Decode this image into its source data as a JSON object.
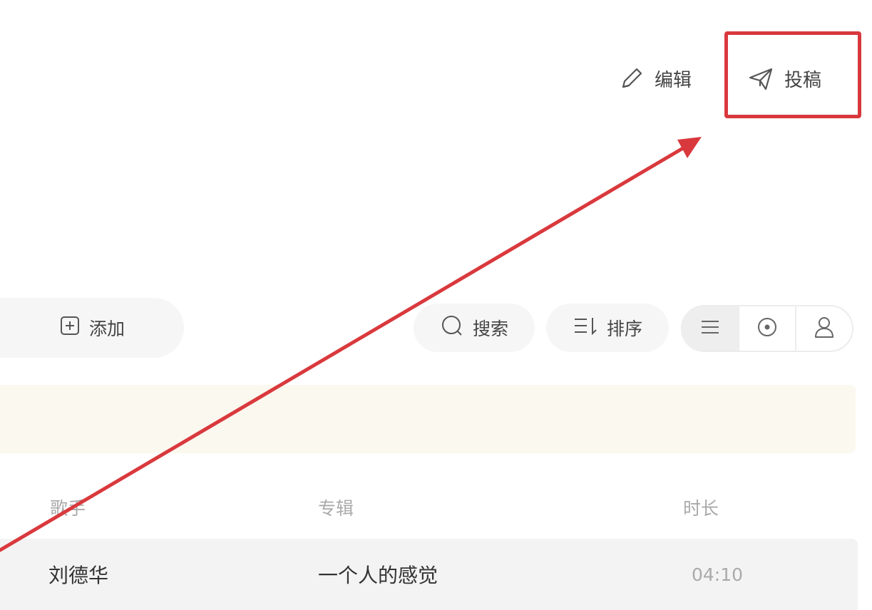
{
  "header": {
    "edit_label": "编辑",
    "submit_label": "投稿",
    "edit_icon": "pencil-icon",
    "submit_icon": "paper-plane-icon"
  },
  "toolbar": {
    "add_label": "添加",
    "add_icon": "plus-square-icon",
    "search_label": "搜索",
    "search_icon": "search-icon",
    "sort_label": "排序",
    "sort_icon": "sort-icon",
    "view_modes": [
      {
        "icon": "list-view-icon",
        "selected": true
      },
      {
        "icon": "album-view-icon",
        "selected": false
      },
      {
        "icon": "artist-view-icon",
        "selected": false
      }
    ]
  },
  "table": {
    "columns": [
      "歌手",
      "专辑",
      "时长"
    ],
    "rows": [
      {
        "artist": "刘德华",
        "album": "一个人的感觉",
        "duration": "04:10"
      }
    ]
  },
  "colors": {
    "annotation_red": "#d9393d",
    "notice_background": "#fbf8ef",
    "row_background": "#f3f3f3"
  }
}
